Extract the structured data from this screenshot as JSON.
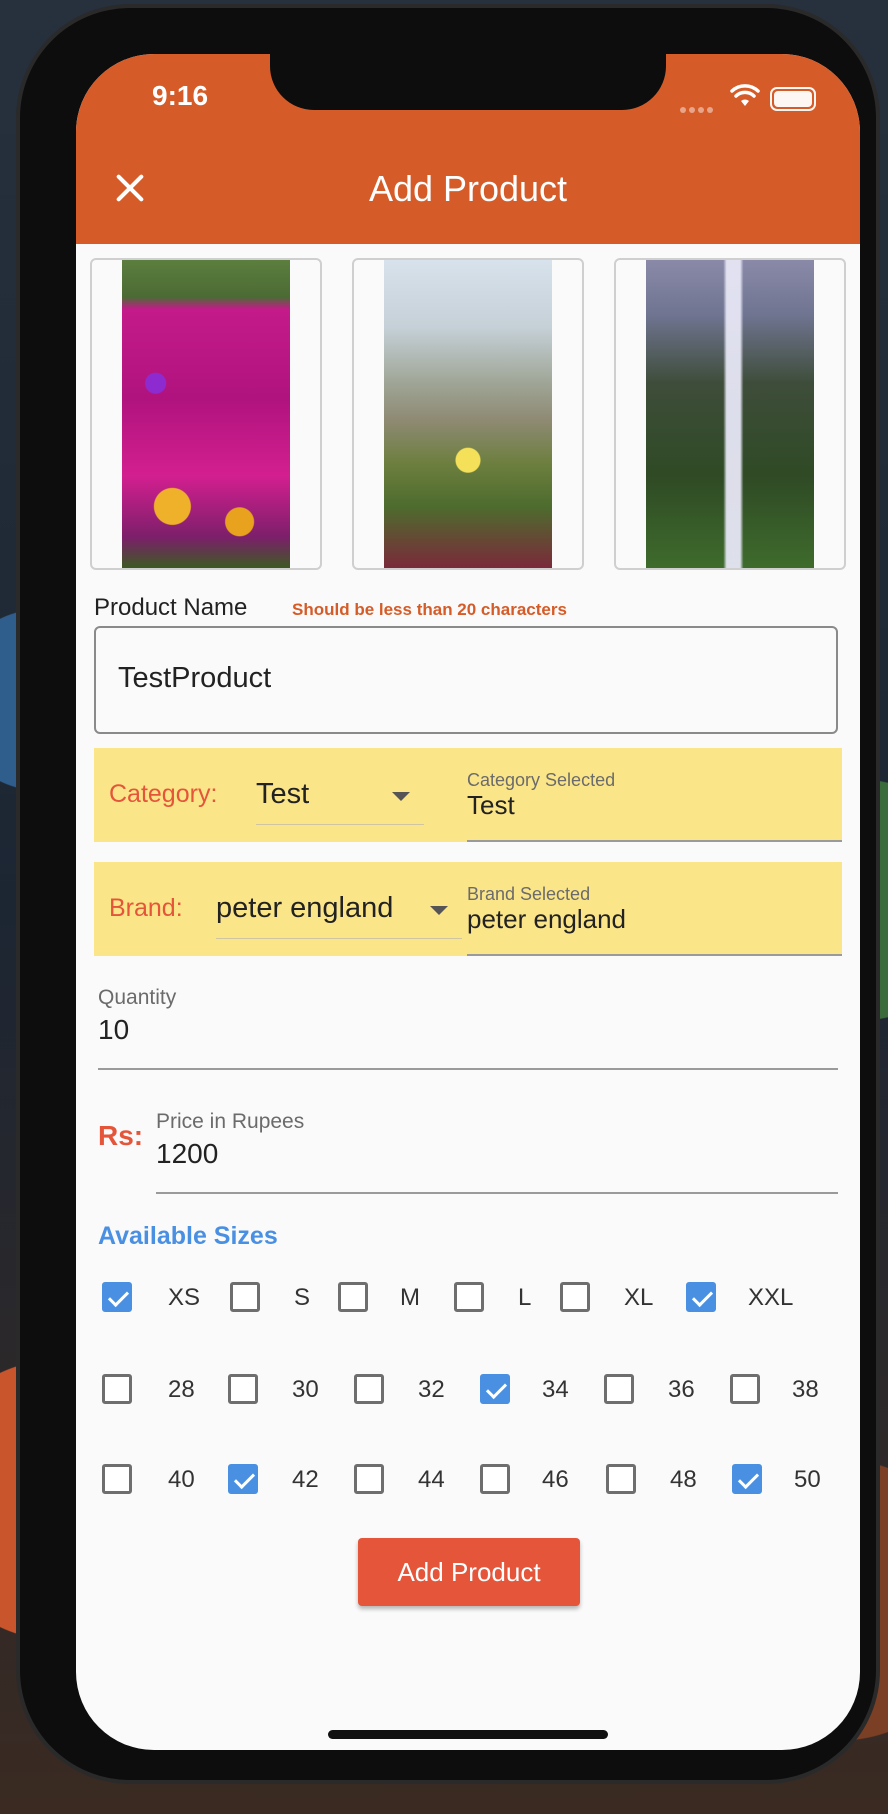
{
  "status_bar": {
    "time": "9:16"
  },
  "appbar": {
    "title": "Add Product",
    "close_icon": "close-icon"
  },
  "images": [
    {
      "name": "pink-flowers-photo"
    },
    {
      "name": "grass-flower-photo"
    },
    {
      "name": "waterfall-photo"
    }
  ],
  "product_name": {
    "label": "Product Name",
    "hint": "Should be less than 20 characters",
    "value": "TestProduct"
  },
  "category": {
    "label": "Category:",
    "dropdown_value": "Test",
    "selected_label": "Category Selected",
    "selected_value": "Test"
  },
  "brand": {
    "label": "Brand:",
    "dropdown_value": "peter england",
    "selected_label": "Brand Selected",
    "selected_value": "peter england"
  },
  "quantity": {
    "label": "Quantity",
    "value": "10"
  },
  "price": {
    "prefix": "Rs:",
    "label": "Price in Rupees",
    "value": "1200"
  },
  "sizes": {
    "title": "Available Sizes",
    "rows": [
      [
        {
          "label": "XS",
          "checked": true
        },
        {
          "label": "S",
          "checked": false
        },
        {
          "label": "M",
          "checked": false
        },
        {
          "label": "L",
          "checked": false
        },
        {
          "label": "XL",
          "checked": false
        },
        {
          "label": "XXL",
          "checked": true
        }
      ],
      [
        {
          "label": "28",
          "checked": false
        },
        {
          "label": "30",
          "checked": false
        },
        {
          "label": "32",
          "checked": false
        },
        {
          "label": "34",
          "checked": true
        },
        {
          "label": "36",
          "checked": false
        },
        {
          "label": "38",
          "checked": false
        }
      ],
      [
        {
          "label": "40",
          "checked": false
        },
        {
          "label": "42",
          "checked": true
        },
        {
          "label": "44",
          "checked": false
        },
        {
          "label": "46",
          "checked": false
        },
        {
          "label": "48",
          "checked": false
        },
        {
          "label": "50",
          "checked": true
        }
      ]
    ]
  },
  "submit_button": {
    "label": "Add Product"
  },
  "colors": {
    "appbar": "#d55c28",
    "accent": "#e4553a",
    "checkbox": "#4a90e2",
    "highlight": "#fbe589"
  }
}
